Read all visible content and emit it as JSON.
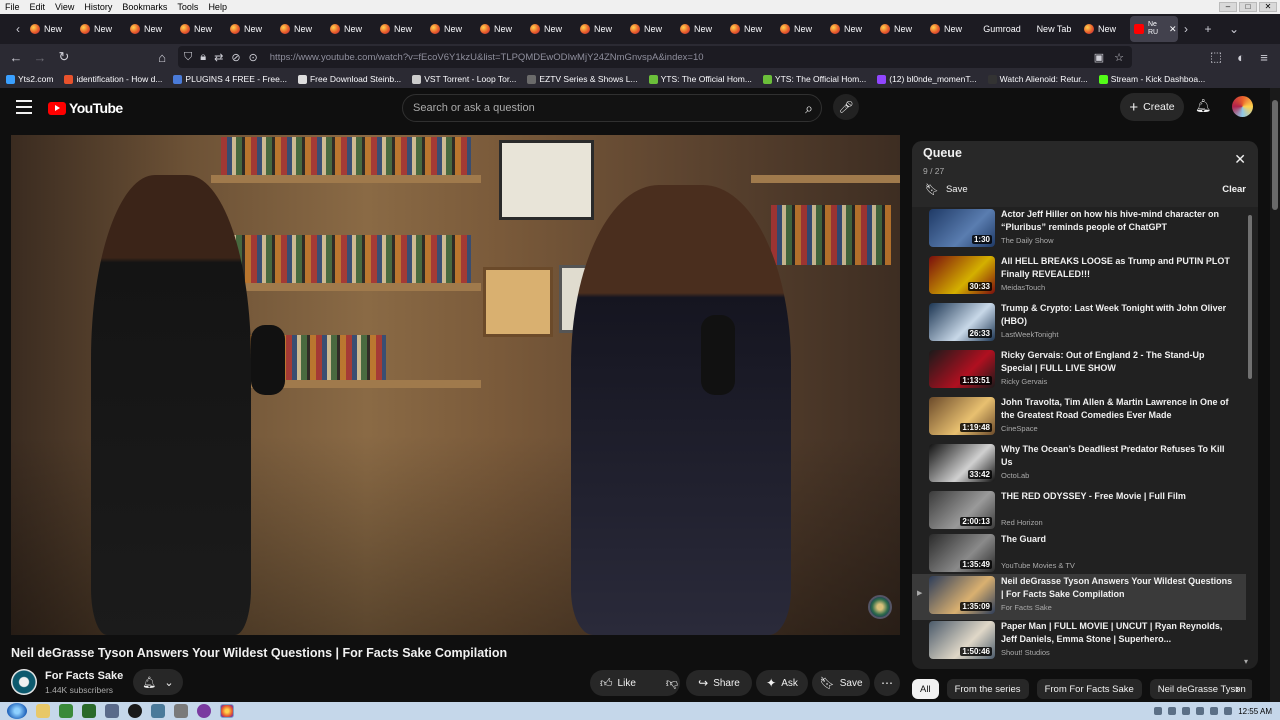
{
  "menubar": {
    "items": [
      "File",
      "Edit",
      "View",
      "History",
      "Bookmarks",
      "Tools",
      "Help"
    ]
  },
  "browser": {
    "tabs": [
      "New",
      "New",
      "New",
      "New",
      "New",
      "New",
      "New",
      "New",
      "New",
      "New",
      "New",
      "New",
      "New",
      "New",
      "New",
      "New",
      "New",
      "New",
      "New"
    ],
    "extra_tabs": [
      "Gumroad",
      "New Tab",
      "New"
    ],
    "active_tab": "Ne RU",
    "url": "https://www.youtube.com/watch?v=fEcoV6Y1kzU&list=TLPQMDEwODIwMjY24ZNmGnvspA&index=10"
  },
  "bookmarks": [
    {
      "label": "Yts2.com",
      "color": "#3aa0ff"
    },
    {
      "label": "identification - How d...",
      "color": "#e8522c"
    },
    {
      "label": "PLUGINS 4 FREE - Free...",
      "color": "#4a7bd9"
    },
    {
      "label": "Free Download Steinb...",
      "color": "#dddddd"
    },
    {
      "label": "VST Torrent - Loop Tor...",
      "color": "#cccccc"
    },
    {
      "label": "EZTV Series & Shows L...",
      "color": "#6b6b6b"
    },
    {
      "label": "YTS: The Official Hom...",
      "color": "#6bbf3a"
    },
    {
      "label": "YTS: The Official Hom...",
      "color": "#6bbf3a"
    },
    {
      "label": "(12) bl0nde_momenT...",
      "color": "#9146ff"
    },
    {
      "label": "Watch Alienoid: Retur...",
      "color": "#333333"
    },
    {
      "label": "Stream - Kick Dashboa...",
      "color": "#53fc18"
    }
  ],
  "youtube": {
    "logo_text": "YouTube",
    "search_placeholder": "Search or ask a question",
    "create_label": "Create"
  },
  "video": {
    "title": "Neil deGrasse Tyson Answers Your Wildest Questions | For Facts Sake Compilation",
    "channel": "For Facts Sake",
    "subscribers": "1.44K subscribers",
    "actions": {
      "like": "Like",
      "share": "Share",
      "ask": "Ask",
      "save": "Save"
    }
  },
  "queue": {
    "title": "Queue",
    "count": "9 / 27",
    "save_label": "Save",
    "clear_label": "Clear",
    "items": [
      {
        "title": "Actor Jeff Hiller on how his hive-mind character on “Pluribus” reminds people of ChatGPT",
        "channel": "The Daily Show",
        "duration": "1:30",
        "thumb": "#1f3a66",
        "thumb2": "#5a7db0"
      },
      {
        "title": "All HELL BREAKS LOOSE as Trump and PUTIN PLOT Finally REVEALED!!!",
        "channel": "MeidasTouch",
        "duration": "30:33",
        "thumb": "#7a0d0d",
        "thumb2": "#d4b000"
      },
      {
        "title": "Trump & Crypto: Last Week Tonight with John Oliver (HBO)",
        "channel": "LastWeekTonight",
        "duration": "26:33",
        "thumb": "#1c3552",
        "thumb2": "#c8d8e8"
      },
      {
        "title": "Ricky Gervais: Out of England 2 - The Stand-Up Special | FULL LIVE SHOW",
        "channel": "Ricky Gervais",
        "duration": "1:13:51",
        "thumb": "#1a1a1a",
        "thumb2": "#b01020"
      },
      {
        "title": "John Travolta, Tim Allen & Martin Lawrence in One of the Greatest Road Comedies Ever Made",
        "channel": "CineSpace",
        "duration": "1:19:48",
        "thumb": "#6b4a2a",
        "thumb2": "#e8c070"
      },
      {
        "title": "Why The Ocean’s Deadliest Predator Refuses To Kill Us",
        "channel": "OctoLab",
        "duration": "33:42",
        "thumb": "#111111",
        "thumb2": "#d0d0d0"
      },
      {
        "title": "THE RED ODYSSEY - Free Movie | Full Film",
        "channel": "Red Horizon",
        "duration": "2:00:13",
        "thumb": "#3a3a3a",
        "thumb2": "#9a9a9a"
      },
      {
        "title": "The Guard",
        "channel": "YouTube Movies & TV",
        "duration": "1:35:49",
        "thumb": "#2a2a2a",
        "thumb2": "#8a8a8a"
      },
      {
        "title": "Neil deGrasse Tyson Answers Your Wildest Questions | For Facts Sake Compilation",
        "channel": "For Facts Sake",
        "duration": "1:35:09",
        "thumb": "#2d3d5a",
        "thumb2": "#d9b070",
        "active": true
      },
      {
        "title": "Paper Man | FULL MOVIE | UNCUT | Ryan Reynolds, Jeff Daniels, Emma Stone | Superhero...",
        "channel": "Shout! Studios",
        "duration": "1:50:46",
        "thumb": "#4a5a6a",
        "thumb2": "#e0d8c8"
      }
    ]
  },
  "chips": [
    "All",
    "From the series",
    "From For Facts Sake",
    "Neil deGrasse Tyson"
  ],
  "taskbar": {
    "clock": "12:55 AM"
  }
}
